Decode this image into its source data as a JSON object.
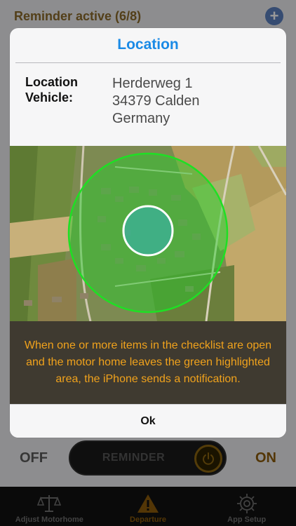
{
  "header": {
    "title": "Reminder active (6/8)",
    "add_icon": "plus-icon"
  },
  "dialog": {
    "title": "Location",
    "location_label": "Location Vehicle:",
    "address_lines": [
      "Herderweg 1",
      "34379 Calden",
      "Germany"
    ],
    "notice": "When one or more items in the checklist are open and the motor home leaves the green highlighted area, the iPhone sends a notification.",
    "ok_label": "Ok"
  },
  "reminder": {
    "off_label": "OFF",
    "switch_label": "REMINDER",
    "on_label": "ON",
    "knob_icon": "power-icon"
  },
  "tabs": [
    {
      "label": "Adjust Motorhome",
      "icon": "scale-icon",
      "active": false
    },
    {
      "label": "Departure",
      "icon": "warning-icon",
      "active": true
    },
    {
      "label": "App Setup",
      "icon": "gear-icon",
      "active": false
    }
  ],
  "colors": {
    "title_blue": "#1a8ae6",
    "notice_orange": "#f0a21c",
    "geofence_green": "#22d12a",
    "accent_brown": "#8a5a0a"
  }
}
